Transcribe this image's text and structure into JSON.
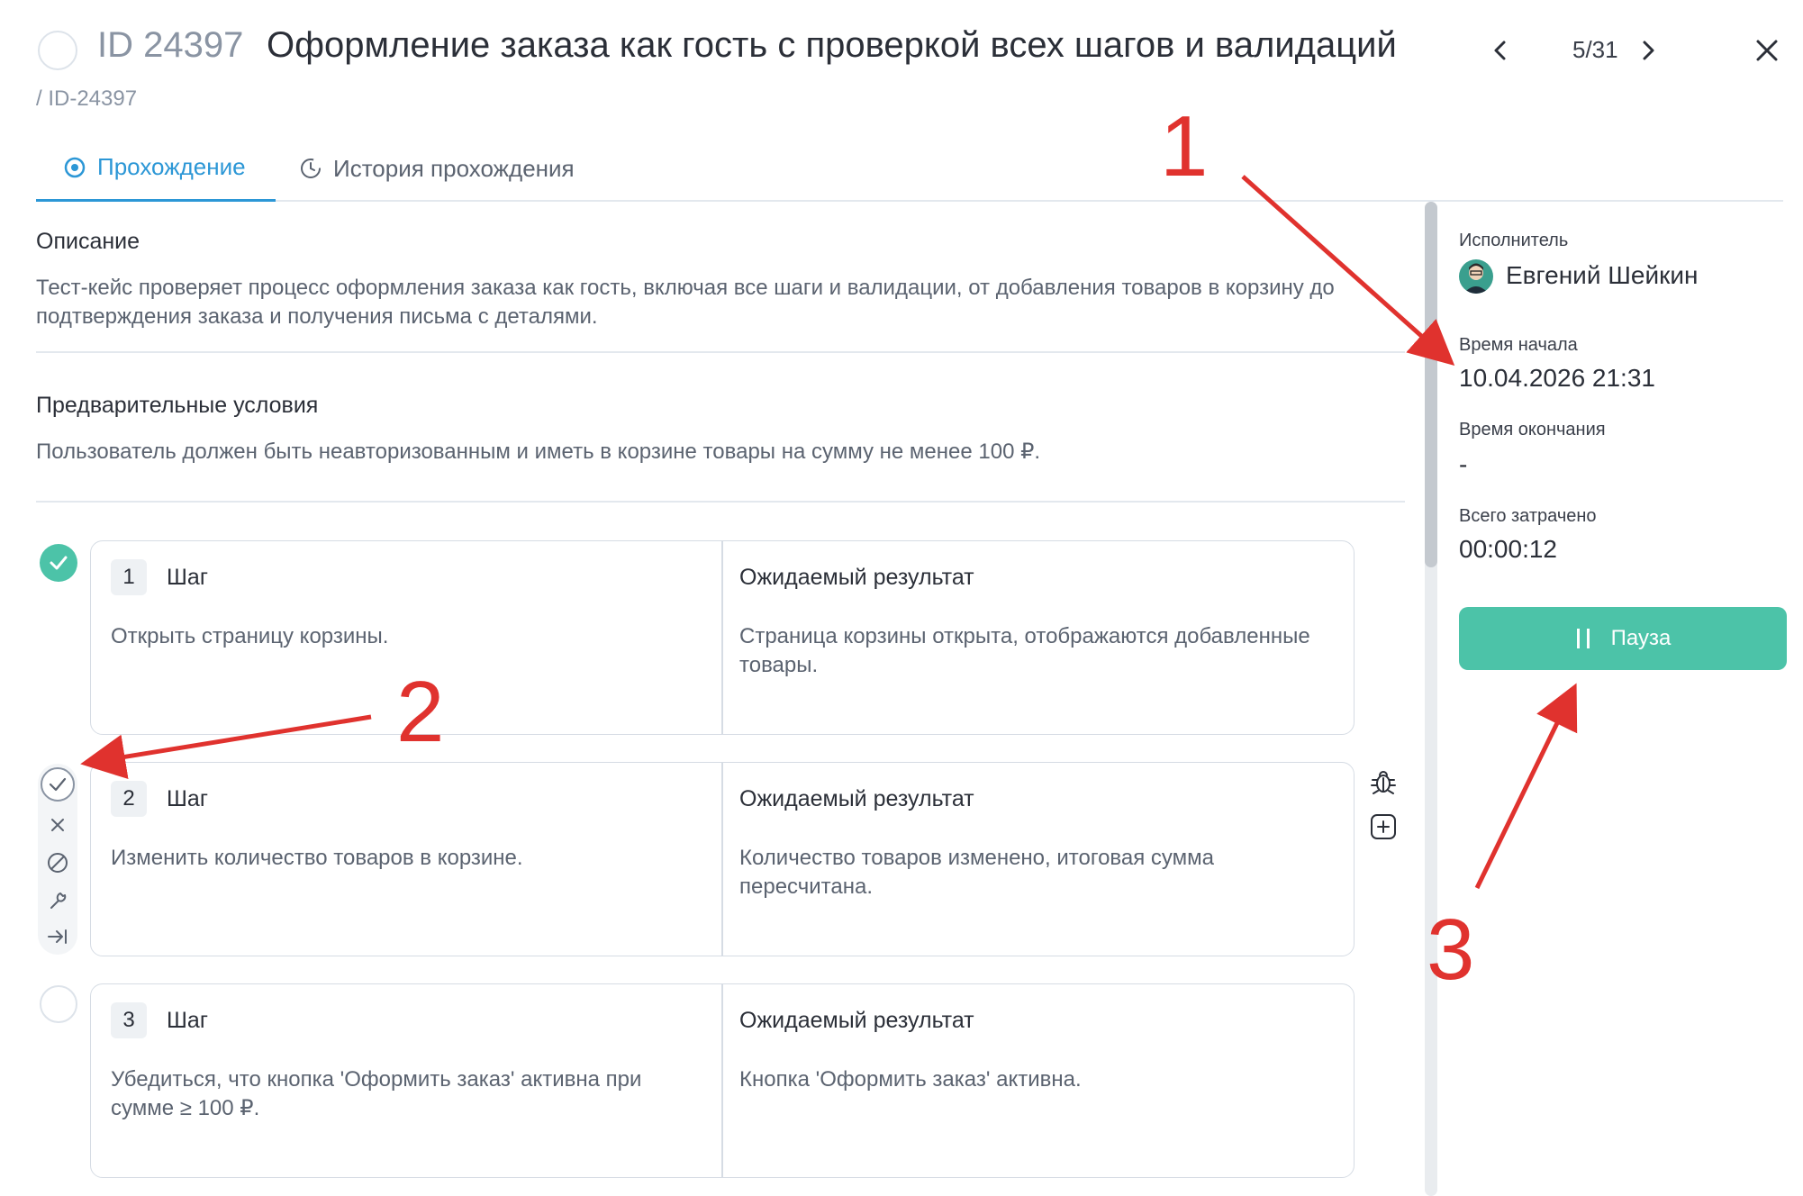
{
  "header": {
    "id_label": "ID 24397",
    "title": "Оформление заказа как гость с проверкой всех шагов и валидаций",
    "breadcrumb": "/ ID-24397",
    "pager": "5/31"
  },
  "tabs": [
    {
      "label": "Прохождение",
      "active": true
    },
    {
      "label": "История прохождения",
      "active": false
    }
  ],
  "description": {
    "title": "Описание",
    "text": "Тест-кейс проверяет процесс оформления заказа как гость, включая все шаги и валидации, от добавления товаров в корзину до подтверждения заказа и получения письма с деталями."
  },
  "preconditions": {
    "title": "Предварительные условия",
    "text": "Пользователь должен быть неавторизованным и иметь в корзине товары на сумму не менее 100 ₽."
  },
  "steps": [
    {
      "num": "1",
      "step_label": "Шаг",
      "expected_label": "Ожидаемый результат",
      "step_text": "Открыть страницу корзины.",
      "expected_text": "Страница корзины открыта, отображаются добавленные товары.",
      "status": "passed"
    },
    {
      "num": "2",
      "step_label": "Шаг",
      "expected_label": "Ожидаемый результат",
      "step_text": "Изменить количество товаров в корзине.",
      "expected_text": "Количество товаров изменено, итоговая сумма пересчитана.",
      "status": "active"
    },
    {
      "num": "3",
      "step_label": "Шаг",
      "expected_label": "Ожидаемый результат",
      "step_text": "Убедиться, что кнопка 'Оформить заказ' активна при сумме ≥ 100 ₽.",
      "expected_text": "Кнопка 'Оформить заказ' активна.",
      "status": "pending"
    }
  ],
  "sidebar": {
    "executor_label": "Исполнитель",
    "executor_name": "Евгений Шейкин",
    "start_label": "Время начала",
    "start_value": "10.04.2026 21:31",
    "end_label": "Время окончания",
    "end_value": "-",
    "total_label": "Всего затрачено",
    "total_value": "00:00:12",
    "pause_label": "Пауза"
  },
  "annotations": [
    "1",
    "2",
    "3"
  ],
  "colors": {
    "accent": "#2c97d6",
    "success": "#4cc3a8",
    "annotation": "#e0322e"
  }
}
